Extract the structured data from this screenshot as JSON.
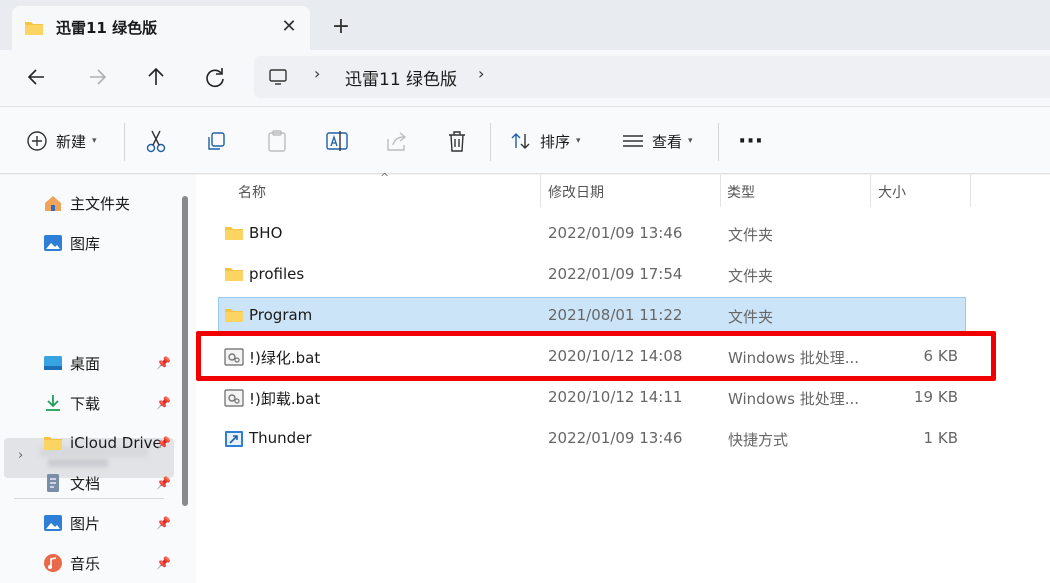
{
  "tab": {
    "title": "迅雷11 绿色版",
    "close": "✕",
    "new": "+"
  },
  "nav": {
    "back": "←",
    "forward": "→",
    "up": "↑",
    "refresh": "↻"
  },
  "address": {
    "breadcrumb": "迅雷11 绿色版"
  },
  "toolbar": {
    "new_label": "新建",
    "sort_label": "排序",
    "view_label": "查看",
    "more": "···"
  },
  "sidebar": {
    "items": [
      {
        "label": "主文件夹"
      },
      {
        "label": "图库"
      },
      {
        "label": "桌面"
      },
      {
        "label": "下载"
      },
      {
        "label": "iCloud Drive"
      },
      {
        "label": "文档"
      },
      {
        "label": "图片"
      },
      {
        "label": "音乐"
      }
    ]
  },
  "columns": {
    "name": "名称",
    "date": "修改日期",
    "type": "类型",
    "size": "大小"
  },
  "files": [
    {
      "name": "BHO",
      "date": "2022/01/09 13:46",
      "type": "文件夹",
      "size": ""
    },
    {
      "name": "profiles",
      "date": "2022/01/09 17:54",
      "type": "文件夹",
      "size": ""
    },
    {
      "name": "Program",
      "date": "2021/08/01 11:22",
      "type": "文件夹",
      "size": ""
    },
    {
      "name": "!)绿化.bat",
      "date": "2020/10/12 14:08",
      "type": "Windows 批处理...",
      "size": "6 KB"
    },
    {
      "name": "!)卸载.bat",
      "date": "2020/10/12 14:11",
      "type": "Windows 批处理...",
      "size": "19 KB"
    },
    {
      "name": "Thunder",
      "date": "2022/01/09 13:46",
      "type": "快捷方式",
      "size": "1 KB"
    }
  ],
  "colors": {
    "selection": "#cce4f7",
    "highlight_box": "#f00000",
    "folder": "#f6c445"
  }
}
